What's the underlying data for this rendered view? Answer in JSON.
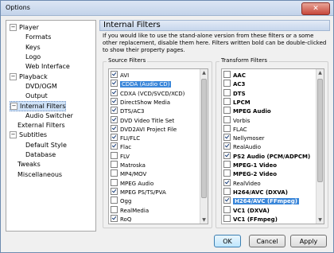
{
  "window": {
    "title": "Options",
    "close_glyph": "✕"
  },
  "tree": [
    {
      "label": "Player",
      "expander": "−",
      "indent": 0,
      "selected": false
    },
    {
      "label": "Formats",
      "expander": "",
      "indent": 2,
      "selected": false
    },
    {
      "label": "Keys",
      "expander": "",
      "indent": 2,
      "selected": false
    },
    {
      "label": "Logo",
      "expander": "",
      "indent": 2,
      "selected": false
    },
    {
      "label": "Web Interface",
      "expander": "",
      "indent": 2,
      "selected": false
    },
    {
      "label": "Playback",
      "expander": "−",
      "indent": 0,
      "selected": false
    },
    {
      "label": "DVD/OGM",
      "expander": "",
      "indent": 2,
      "selected": false
    },
    {
      "label": "Output",
      "expander": "",
      "indent": 2,
      "selected": false
    },
    {
      "label": "Internal Filters",
      "expander": "−",
      "indent": 0,
      "selected": true
    },
    {
      "label": "Audio Switcher",
      "expander": "",
      "indent": 2,
      "selected": false
    },
    {
      "label": "External Filters",
      "expander": "",
      "indent": 1,
      "selected": false
    },
    {
      "label": "Subtitles",
      "expander": "−",
      "indent": 0,
      "selected": false
    },
    {
      "label": "Default Style",
      "expander": "",
      "indent": 2,
      "selected": false
    },
    {
      "label": "Database",
      "expander": "",
      "indent": 2,
      "selected": false
    },
    {
      "label": "Tweaks",
      "expander": "",
      "indent": 1,
      "selected": false
    },
    {
      "label": "Miscellaneous",
      "expander": "",
      "indent": 1,
      "selected": false
    }
  ],
  "panel": {
    "title": "Internal Filters",
    "description": "If you would like to use the stand-alone version from these filters or a some other replacement, disable them here. Filters written bold can be double-clicked to show their property pages."
  },
  "source": {
    "label": "Source Filters",
    "items": [
      {
        "text": "AVI",
        "checked": true,
        "bold": false,
        "highlight": false
      },
      {
        "text": "CDDA (Audio CD)",
        "checked": true,
        "bold": false,
        "highlight": true
      },
      {
        "text": "CDXA (VCD/SVCD/XCD)",
        "checked": true,
        "bold": false,
        "highlight": false
      },
      {
        "text": "DirectShow Media",
        "checked": true,
        "bold": false,
        "highlight": false
      },
      {
        "text": "DTS/AC3",
        "checked": true,
        "bold": false,
        "highlight": false
      },
      {
        "text": "DVD Video Title Set",
        "checked": true,
        "bold": false,
        "highlight": false
      },
      {
        "text": "DVD2AVI Project File",
        "checked": true,
        "bold": false,
        "highlight": false
      },
      {
        "text": "FLI/FLC",
        "checked": true,
        "bold": false,
        "highlight": false
      },
      {
        "text": "Flac",
        "checked": true,
        "bold": false,
        "highlight": false
      },
      {
        "text": "FLV",
        "checked": false,
        "bold": false,
        "highlight": false
      },
      {
        "text": "Matroska",
        "checked": false,
        "bold": false,
        "highlight": false
      },
      {
        "text": "MP4/MOV",
        "checked": false,
        "bold": false,
        "highlight": false
      },
      {
        "text": "MPEG Audio",
        "checked": false,
        "bold": false,
        "highlight": false
      },
      {
        "text": "MPEG PS/TS/PVA",
        "checked": true,
        "bold": false,
        "highlight": false
      },
      {
        "text": "Ogg",
        "checked": false,
        "bold": false,
        "highlight": false
      },
      {
        "text": "RealMedia",
        "checked": false,
        "bold": false,
        "highlight": false
      },
      {
        "text": "RoQ",
        "checked": true,
        "bold": false,
        "highlight": false
      }
    ]
  },
  "transform": {
    "label": "Transform Filters",
    "items": [
      {
        "text": "AAC",
        "checked": false,
        "bold": true,
        "highlight": false
      },
      {
        "text": "AC3",
        "checked": false,
        "bold": true,
        "highlight": false
      },
      {
        "text": "DTS",
        "checked": false,
        "bold": true,
        "highlight": false
      },
      {
        "text": "LPCM",
        "checked": false,
        "bold": true,
        "highlight": false
      },
      {
        "text": "MPEG Audio",
        "checked": false,
        "bold": true,
        "highlight": false
      },
      {
        "text": "Vorbis",
        "checked": false,
        "bold": false,
        "highlight": false
      },
      {
        "text": "FLAC",
        "checked": false,
        "bold": false,
        "highlight": false
      },
      {
        "text": "Nellymoser",
        "checked": true,
        "bold": false,
        "highlight": false
      },
      {
        "text": "RealAudio",
        "checked": true,
        "bold": false,
        "highlight": false
      },
      {
        "text": "PS2 Audio (PCM/ADPCM)",
        "checked": true,
        "bold": true,
        "highlight": false
      },
      {
        "text": "MPEG-1 Video",
        "checked": false,
        "bold": true,
        "highlight": false
      },
      {
        "text": "MPEG-2 Video",
        "checked": false,
        "bold": true,
        "highlight": false
      },
      {
        "text": "RealVideo",
        "checked": true,
        "bold": false,
        "highlight": false
      },
      {
        "text": "H264/AVC (DXVA)",
        "checked": false,
        "bold": true,
        "highlight": false
      },
      {
        "text": "H264/AVC (FFmpeg)",
        "checked": true,
        "bold": true,
        "highlight": true
      },
      {
        "text": "VC1 (DXVA)",
        "checked": false,
        "bold": true,
        "highlight": false
      },
      {
        "text": "VC1 (FFmpeg)",
        "checked": false,
        "bold": true,
        "highlight": false
      }
    ]
  },
  "buttons": {
    "ok": "OK",
    "cancel": "Cancel",
    "apply": "Apply"
  },
  "scroll_glyphs": {
    "up": "▲",
    "down": "▼"
  },
  "colors": {
    "selection": "#3a86d9",
    "tree_selection": "#cfe2f7"
  }
}
